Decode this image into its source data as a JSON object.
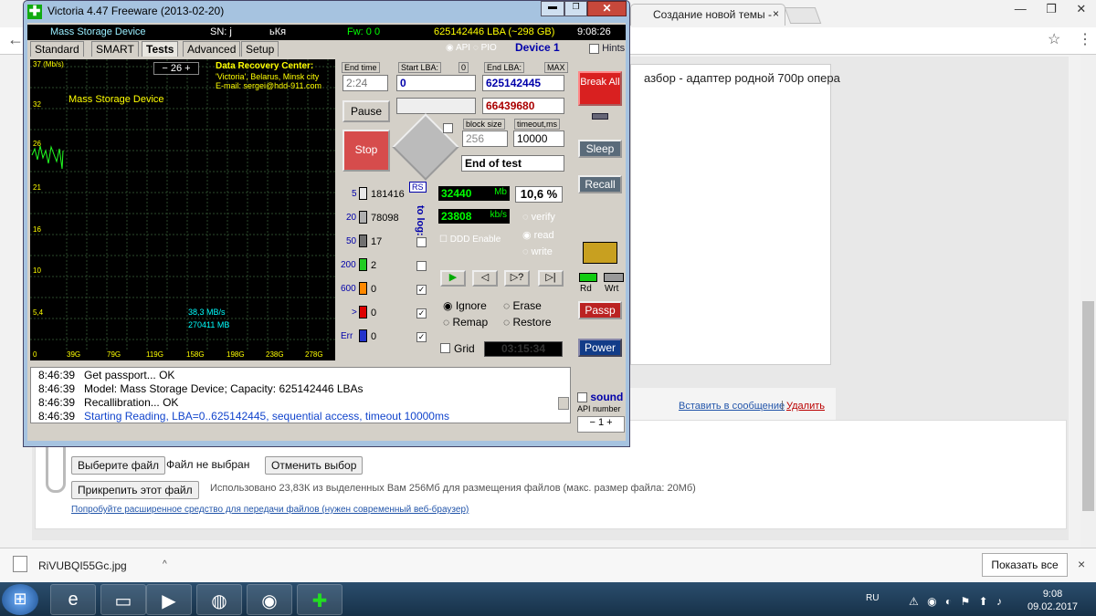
{
  "browser": {
    "tab_title": "Создание новой темы -",
    "tab_close": "×",
    "back": "←",
    "star": "☆",
    "menu": "⋮",
    "controls": [
      "—",
      "❐",
      "✕"
    ]
  },
  "forum": {
    "editor_text": "азбор - адаптер родной 700р  опера",
    "insert_link": "Вставить в сообщение",
    "separator": "|",
    "delete_link": "Удалить",
    "choose_file": "Выберите файл",
    "no_file": "Файл не выбран",
    "cancel_choice": "Отменить выбор",
    "attach_file": "Прикрепить этот файл",
    "usage": "Использовано 23,83К из выделенных Вам 256Мб для размещения файлов (макс. размер файла: 20Мб)",
    "try_link": "Попробуйте расширенное средство для передачи файлов (нужен современный веб-браузер)"
  },
  "downloads": {
    "file": "RiVUBQI55Gc.jpg",
    "arrow": "^",
    "show_all": "Показать все",
    "close": "×"
  },
  "taskbar": {
    "lang": "RU",
    "time": "9:08",
    "date": "09.02.2017",
    "tray": "⚠ ◉ ◐ ⚑ ⬆ ♪"
  },
  "victoria": {
    "title": "Victoria 4.47  Freeware (2013-02-20)",
    "icon": "✚",
    "win_min": "▬",
    "win_max": "❐",
    "win_close": "✕",
    "model": "Mass Storage Device",
    "sn": "SN: j",
    "sn2": "ьКя",
    "fw": "Fw: 0 0",
    "lba_total": "625142446 LBA (~298 GB)",
    "clock": "9:08:26",
    "tabs": [
      "Standard",
      "SMART",
      "Tests",
      "Advanced",
      "Setup"
    ],
    "mode": "◉ API ◌ PIO",
    "device": "Device 1",
    "hints": "Hints",
    "graph": {
      "y_unit": "37 (Mb/s)",
      "y_ticks": [
        "32",
        "26",
        "21",
        "16",
        "10",
        "5,4",
        "0"
      ],
      "x_ticks": [
        "39G",
        "79G",
        "119G",
        "158G",
        "198G",
        "238G",
        "278G"
      ],
      "counter": "−  26  +",
      "drc_title": "Data Recovery Center:",
      "drc_line1": "'Victoria', Belarus, Minsk city",
      "drc_line2": "E-mail: sergei@hdd-911.com",
      "model_label": "Mass Storage Device",
      "speed": "38,3 MB/s",
      "size": "270411 MB"
    },
    "end_time_lbl": "End time",
    "end_time": "2:24",
    "start_lba_lbl": "Start LBA:",
    "start_zero": "0",
    "end_lba_lbl": "End LBA:",
    "max_lbl": "MAX",
    "start_lba": "0",
    "end_lba": "625142445",
    "cur_lba": "66439680",
    "pause": "Pause",
    "stop": "Stop",
    "block_size_lbl": "block size",
    "timeout_lbl": "timeout,ms",
    "block_size": "256",
    "timeout": "10000",
    "end_of_test": "End of test",
    "rs": "RS",
    "to_log": "to log:",
    "blocks": [
      {
        "ms": "5",
        "count": "181416",
        "color": "#e8e8e8"
      },
      {
        "ms": "20",
        "count": "78098",
        "color": "#b0b0b0"
      },
      {
        "ms": "50",
        "count": "17",
        "color": "#707070"
      },
      {
        "ms": "200",
        "count": "2",
        "color": "#22cc22"
      },
      {
        "ms": "600",
        "count": "0",
        "color": "#ff8800"
      },
      {
        "ms": ">",
        "count": "0",
        "color": "#dd0000"
      },
      {
        "ms": "Err",
        "count": "0",
        "color": "#2233cc"
      }
    ],
    "mb_done": "32440",
    "mb_unit": "Mb",
    "percent": "10,6 %",
    "kbs": "23808",
    "kbs_unit": "kb/s",
    "verify": "verify",
    "read": "read",
    "write": "write",
    "ddd": "DDD Enable",
    "ignore": "Ignore",
    "erase": "Erase",
    "remap": "Remap",
    "restore": "Restore",
    "grid": "Grid",
    "timer": "03:15:34",
    "break_all": "Break All",
    "sleep": "Sleep",
    "recall": "Recall",
    "rd": "Rd",
    "wrt": "Wrt",
    "passp": "Passp",
    "power": "Power",
    "sound": "sound",
    "api_number": "API number",
    "api_value": "1",
    "log": [
      {
        "time": "8:46:39",
        "text": "Get passport... OK",
        "color": "#000"
      },
      {
        "time": "8:46:39",
        "text": "Model: Mass Storage Device; Capacity: 625142446 LBAs",
        "color": "#000"
      },
      {
        "time": "8:46:39",
        "text": "Recallibration... OK",
        "color": "#000"
      },
      {
        "time": "8:46:39",
        "text": "Starting Reading, LBA=0..625142445, sequential access, timeout 10000ms",
        "color": "#1144cc"
      }
    ]
  }
}
